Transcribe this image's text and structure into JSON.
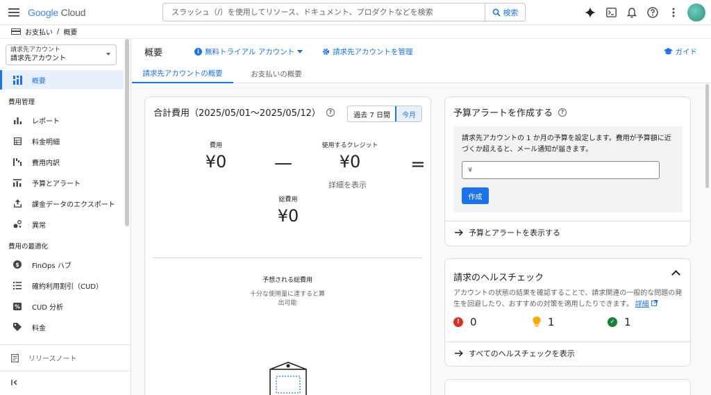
{
  "header": {
    "logo_google": "Google",
    "logo_cloud": "Cloud",
    "search_placeholder": "スラッシュ（/）を使用してリソース、ドキュメント、プロダクトなどを検索",
    "search_button": "検索"
  },
  "breadcrumb": {
    "item1": "お支払い",
    "sep": "/",
    "item2": "概要"
  },
  "sidebar": {
    "account_label": "請求先アカウント",
    "account_value": "請求先アカウント",
    "overview": "概要",
    "section_cost": "費用管理",
    "reports": "レポート",
    "statements": "料金明細",
    "breakdown": "費用内訳",
    "budgets": "予算とアラート",
    "export": "課金データのエクスポート",
    "anomalies": "異常",
    "section_opt": "費用の最適化",
    "finops": "FinOps ハブ",
    "cud": "確約利用割引（CUD）",
    "cud_analysis": "CUD 分析",
    "pricing": "料金",
    "release_notes": "リリースノート",
    "collapse": "<|"
  },
  "main": {
    "title": "概要",
    "trial": "無料トライアル アカウント",
    "manage": "請求先アカウントを管理",
    "guide": "ガイド",
    "tabs": [
      "請求先アカウントの概要",
      "お支払いの概要"
    ]
  },
  "cost_card": {
    "title": "合計費用（2025/05/01〜2025/05/12）",
    "seg_past7": "過去 7 日間",
    "seg_month": "今月",
    "cost_label": "費用",
    "cost_value": "¥0",
    "minus": "—",
    "credit_label": "使用するクレジット",
    "credit_value": "¥0",
    "equals": "=",
    "detail": "詳細を表示",
    "total_label": "総費用",
    "total_value": "¥0",
    "forecast_title": "予想される総費用",
    "forecast_msg1": "十分な使用量に達すると算",
    "forecast_msg2": "出可能"
  },
  "budget_card": {
    "title": "予算アラートを作成する",
    "desc": "請求先アカウントの 1 か月の予算を設定します。費用が予算額に近づくか超えると、メール通知が届きます。",
    "input_placeholder": "¥",
    "create": "作成",
    "link": "予算とアラートを表示する"
  },
  "health_card": {
    "title": "請求のヘルスチェック",
    "desc": "アカウントの状態の結果を確認することで、請求関連の一般的な問題の発生を回避したり、おすすめの対策を適用したりできます。",
    "detail": "詳細",
    "errors": "0",
    "warnings": "1",
    "ok": "1",
    "link": "すべてのヘルスチェックを表示"
  },
  "colors": {
    "primary": "#1a73e8",
    "error": "#d93025",
    "warning": "#f9ab00",
    "success": "#188038"
  }
}
